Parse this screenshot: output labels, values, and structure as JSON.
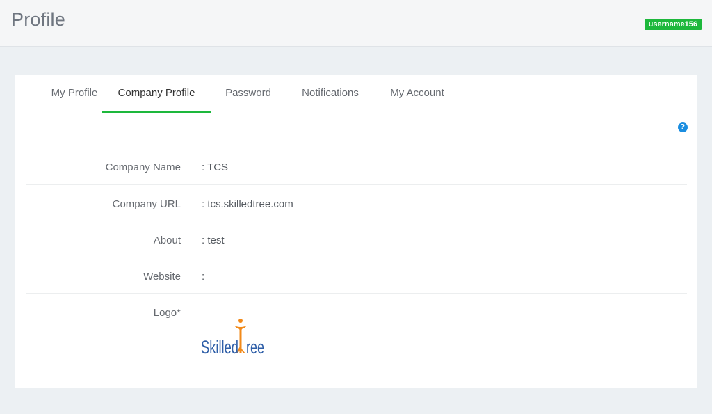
{
  "header": {
    "title": "Profile",
    "username": "username156"
  },
  "tabs": [
    {
      "label": "My Profile",
      "active": false
    },
    {
      "label": "Company Profile",
      "active": true
    },
    {
      "label": "Password",
      "active": false
    },
    {
      "label": "Notifications",
      "active": false
    },
    {
      "label": "My Account",
      "active": false
    }
  ],
  "help_icon": {
    "name": "question-circle-icon",
    "glyph": "?"
  },
  "fields": [
    {
      "label": "Company Name",
      "value": ": TCS"
    },
    {
      "label": "Company URL",
      "value": ": tcs.skilledtree.com"
    },
    {
      "label": "About",
      "value": ": test"
    },
    {
      "label": "Website",
      "value": ":"
    },
    {
      "label": "Logo*",
      "value": ""
    }
  ],
  "logo": {
    "text": "SkilledTree"
  },
  "colors": {
    "accent": "#1db83c",
    "help_blue": "#1a8de0",
    "logo_blue": "#2f5fa8",
    "logo_orange": "#f28a1a"
  }
}
